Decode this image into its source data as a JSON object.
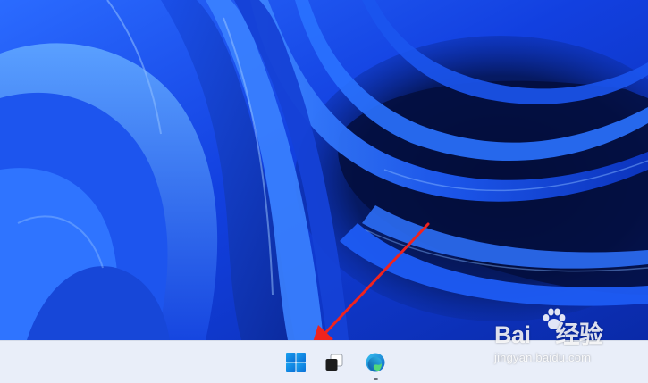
{
  "desktop": {
    "wallpaper": "windows-11-bloom-icon",
    "colors": {
      "wallpaper_primary": "#1346e8",
      "wallpaper_dark": "#061447",
      "taskbar": "#e9eef9",
      "annotation_arrow": "#f0231e"
    }
  },
  "annotation": {
    "arrow_icon": "red-arrow-icon",
    "target": "start-button"
  },
  "taskbar": {
    "items": [
      {
        "name": "Start",
        "icon": "windows-logo-icon",
        "running": false
      },
      {
        "name": "Task View",
        "icon": "task-view-icon",
        "running": false
      },
      {
        "name": "Microsoft Edge",
        "icon": "edge-icon",
        "running": true
      }
    ]
  },
  "watermark": {
    "logo_text": "Bai",
    "logo_paw_icon": "baidu-paw-icon",
    "logo_suffix": "经验",
    "url": "jingyan.baidu.com"
  }
}
